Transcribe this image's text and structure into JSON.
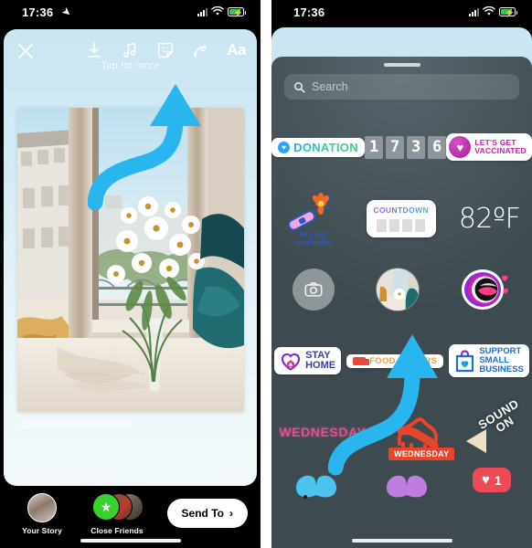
{
  "left_phone": {
    "status_bar": {
      "time": "17:36",
      "location_icon": "location-arrow-icon",
      "signal_icon": "cellular-signal-icon",
      "wifi_icon": "wifi-icon",
      "battery_icon": "battery-charging-icon"
    },
    "editor": {
      "close_label": "✕",
      "hint": "Tap for more",
      "tools": [
        {
          "name": "download-icon",
          "label": "Download"
        },
        {
          "name": "music-icon",
          "label": "Music"
        },
        {
          "name": "sticker-icon",
          "label": "Stickers"
        },
        {
          "name": "draw-icon",
          "label": "Draw"
        },
        {
          "name": "text-icon",
          "label": "Aa"
        }
      ]
    },
    "send_bar": {
      "your_story_label": "Your Story",
      "close_friends_label": "Close Friends",
      "send_to_label": "Send To",
      "chevron": "›"
    }
  },
  "right_phone": {
    "status_bar": {
      "time": "17:36",
      "signal_icon": "cellular-signal-icon",
      "wifi_icon": "wifi-icon",
      "battery_icon": "battery-charging-icon"
    },
    "tray": {
      "search_placeholder": "Search",
      "search_icon": "search-icon",
      "grabber": "drag-handle"
    },
    "stickers": {
      "row1": [
        {
          "id": "donation",
          "label": "DONATION",
          "icon": "heart-circle-icon"
        },
        {
          "id": "time",
          "digits": [
            "1",
            "7",
            "3",
            "6"
          ]
        },
        {
          "id": "lets-get-vaccinated-badge",
          "line1": "LET'S GET",
          "line2": "VACCINATED",
          "icon": "vaccine-heart-icon"
        }
      ],
      "row2": [
        {
          "id": "vaccinated-bandaid",
          "line1": "let's get",
          "line2": "vaccinated"
        },
        {
          "id": "countdown",
          "label": "COUNTDOWN"
        },
        {
          "id": "temperature",
          "value": "82ºF"
        }
      ],
      "row3": [
        {
          "id": "camera",
          "icon": "camera-icon"
        },
        {
          "id": "photo-sticker",
          "icon": "photo-thumbnail"
        },
        {
          "id": "mouth-sticker",
          "icon": "mouth-hearts-icon"
        }
      ],
      "row4": [
        {
          "id": "stay-home",
          "line1": "STAY",
          "line2": "HOME",
          "icon": "house-heart-icon"
        },
        {
          "id": "food-orders",
          "label": "FOOD ORDERS",
          "icon": "delivery-truck-icon"
        },
        {
          "id": "support-small-business",
          "line1": "SUPPORT",
          "line2": "SMALL",
          "line3": "BUSINESS",
          "icon": "shopping-bag-heart-icon"
        }
      ],
      "row5": [
        {
          "id": "wednesday-text",
          "label": "WEDNESDAY"
        },
        {
          "id": "camel-wednesday",
          "label": "WEDNESDAY"
        },
        {
          "id": "sound-on",
          "line1": "SOUND",
          "line2": "ON"
        }
      ],
      "row6": [
        {
          "id": "butterfly-blue",
          "icon": "butterfly-icon"
        },
        {
          "id": "butterfly-purple",
          "icon": "butterfly-icon"
        },
        {
          "id": "heart-count",
          "count": "1",
          "icon": "heart-icon"
        }
      ]
    }
  },
  "annotations": {
    "arrow_left": "blue-curved-arrow-up",
    "arrow_right": "blue-curved-arrow-up"
  },
  "colors": {
    "accent_blue": "#29b6ef",
    "tray_bg": "#4a5a61",
    "editor_bg": "#cde8f3",
    "send_red": "#ed4956"
  }
}
